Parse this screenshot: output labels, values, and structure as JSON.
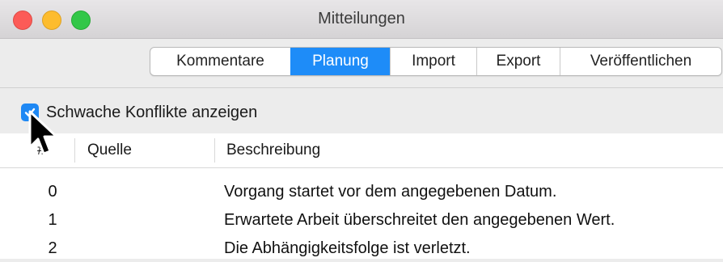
{
  "window": {
    "title": "Mitteilungen"
  },
  "tabs": [
    {
      "label": "Kommentare",
      "active": false
    },
    {
      "label": "Planung",
      "active": true
    },
    {
      "label": "Import",
      "active": false
    },
    {
      "label": "Export",
      "active": false
    },
    {
      "label": "Veröffentlichen",
      "active": false
    }
  ],
  "options": {
    "weak_conflicts_label": "Schwache Konflikte anzeigen",
    "weak_conflicts_checked": true
  },
  "table": {
    "headers": {
      "number": "#",
      "source": "Quelle",
      "description": "Beschreibung"
    },
    "rows": [
      {
        "number": "0",
        "source": "",
        "description": "Vorgang startet vor dem angegebenen Datum."
      },
      {
        "number": "1",
        "source": "",
        "description": "Erwartete Arbeit überschreitet den angegebenen Wert."
      },
      {
        "number": "2",
        "source": "",
        "description": "Die Abhängigkeitsfolge ist verletzt."
      }
    ]
  },
  "colors": {
    "accent": "#1e8cf8",
    "close": "#fc5b57",
    "minimize": "#fdbc2e",
    "zoom": "#33c748"
  }
}
